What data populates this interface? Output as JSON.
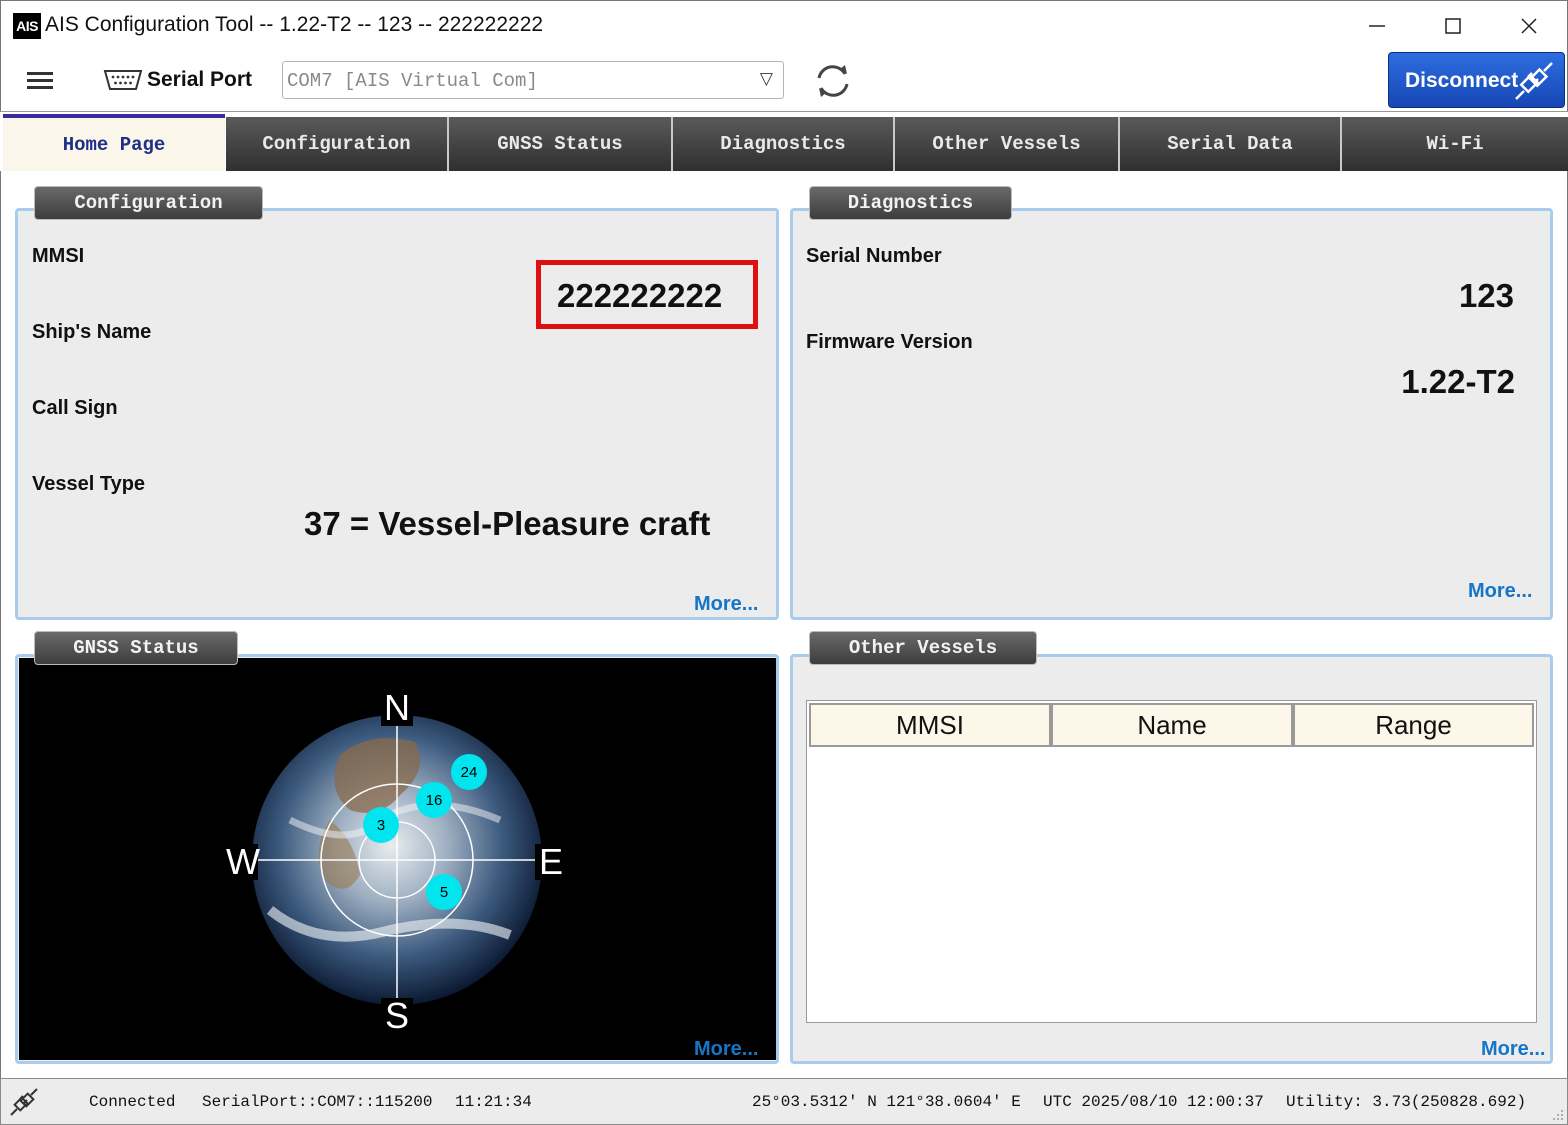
{
  "window": {
    "logo_text": "AIS",
    "title": "AIS Configuration Tool -- 1.22-T2 -- 123 -- 222222222"
  },
  "toolbar": {
    "serial_port_label": "Serial Port",
    "port_value": "COM7 [AIS Virtual Com]",
    "disconnect_label": "Disconnect"
  },
  "tabs": [
    {
      "label": "Home Page",
      "active": true
    },
    {
      "label": "Configuration"
    },
    {
      "label": "GNSS Status"
    },
    {
      "label": "Diagnostics"
    },
    {
      "label": "Other Vessels"
    },
    {
      "label": "Serial Data"
    },
    {
      "label": "Wi-Fi"
    }
  ],
  "configuration": {
    "title": "Configuration",
    "mmsi_label": "MMSI",
    "mmsi_value": "222222222",
    "ship_name_label": "Ship's Name",
    "ship_name_value": "",
    "call_sign_label": "Call Sign",
    "call_sign_value": "",
    "vessel_type_label": "Vessel Type",
    "vessel_type_value": "37 = Vessel-Pleasure craft",
    "more": "More..."
  },
  "diagnostics": {
    "title": "Diagnostics",
    "serial_number_label": "Serial Number",
    "serial_number_value": "123",
    "firmware_label": "Firmware Version",
    "firmware_value": "1.22-T2",
    "more": "More..."
  },
  "gnss": {
    "title": "GNSS Status",
    "compass": {
      "n": "N",
      "s": "S",
      "e": "E",
      "w": "W"
    },
    "satellites": [
      "24",
      "16",
      "3",
      "5"
    ],
    "more": "More..."
  },
  "vessels": {
    "title": "Other Vessels",
    "columns": [
      "MMSI",
      "Name",
      "Range"
    ],
    "rows": [],
    "more": "More..."
  },
  "status": {
    "connection": "Connected",
    "port_info": "SerialPort::COM7::115200",
    "time": "11:21:34",
    "position": "25°03.5312' N 121°38.0604' E",
    "utc": "UTC 2025/08/10 12:00:37",
    "utility": "Utility: 3.73(250828.692)"
  },
  "colors": {
    "accent": "#1647b4",
    "highlight": "#e01010",
    "link": "#1576c8",
    "satellite": "#00e5ee",
    "panel_border": "#a9cbec"
  }
}
